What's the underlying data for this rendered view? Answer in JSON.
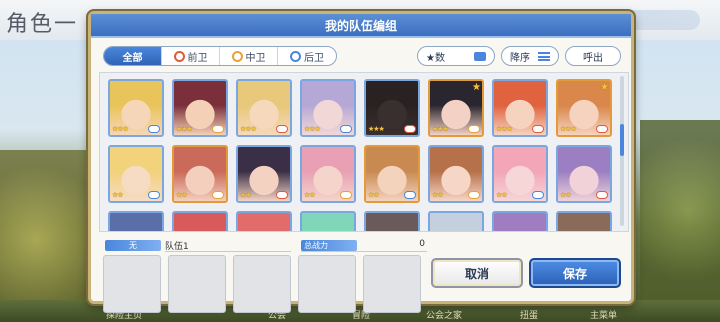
{
  "background": {
    "title": "角色一",
    "bottom_items": [
      "探险主页",
      "公会",
      "冒险",
      "公会之家",
      "扭蛋",
      "主菜单"
    ]
  },
  "dialog": {
    "title": "我的队伍编组",
    "tabs": [
      {
        "label": "全部",
        "active": true
      },
      {
        "label": "前卫",
        "role": "front"
      },
      {
        "label": "中卫",
        "role": "mid"
      },
      {
        "label": "后卫",
        "role": "back"
      }
    ],
    "sort_key": "★数",
    "order": "降序",
    "call_button": "呼出"
  },
  "characters": [
    {
      "stars": "★★★",
      "role": "back",
      "frame": "blue",
      "skin": "#f6d6b8",
      "hair": "#e9c45a"
    },
    {
      "stars": "★★★",
      "role": "mid",
      "frame": "blue",
      "skin": "#f4d0b6",
      "hair": "#7a2f3a"
    },
    {
      "stars": "★★★",
      "role": "front",
      "frame": "blue",
      "skin": "#f6d8bc",
      "hair": "#e8c87a"
    },
    {
      "stars": "★★★",
      "role": "back",
      "frame": "blue",
      "skin": "#f2d7d7",
      "hair": "#b6a8d6"
    },
    {
      "stars": "★★★",
      "role": "front",
      "frame": "blue",
      "skin": "#3a2f2f",
      "hair": "#2a2222"
    },
    {
      "stars": "★★★",
      "role": "mid",
      "frame": "gold",
      "skin": "#f3d1c4",
      "hair": "#2a2630",
      "corner": "★"
    },
    {
      "stars": "★★★",
      "role": "front",
      "frame": "blue",
      "skin": "#f6d3bf",
      "hair": "#e0623f"
    },
    {
      "stars": "★★★",
      "role": "front",
      "frame": "gold",
      "skin": "#f6d3bf",
      "hair": "#d9874a",
      "corner": "★"
    },
    {
      "stars": "★★",
      "role": "back",
      "frame": "blue",
      "skin": "#f6dcc2",
      "hair": "#f2d27a"
    },
    {
      "stars": "★★",
      "role": "mid",
      "frame": "gold",
      "skin": "#f4cfbd",
      "hair": "#c96a5a"
    },
    {
      "stars": "★★",
      "role": "front",
      "frame": "blue",
      "skin": "#f4d2c2",
      "hair": "#3a2f46"
    },
    {
      "stars": "★★",
      "role": "mid",
      "frame": "blue",
      "skin": "#f5d4cc",
      "hair": "#e9a0b4"
    },
    {
      "stars": "★★",
      "role": "back",
      "frame": "gold",
      "skin": "#f4d3bd",
      "hair": "#c98a52"
    },
    {
      "stars": "★★",
      "role": "mid",
      "frame": "blue",
      "skin": "#f6d6c6",
      "hair": "#b7714a"
    },
    {
      "stars": "★★",
      "role": "back",
      "frame": "blue",
      "skin": "#f6d6d6",
      "hair": "#f2a6b8"
    },
    {
      "stars": "★★",
      "role": "front",
      "frame": "blue",
      "skin": "#f0d2d8",
      "hair": "#9b7fc2"
    },
    {
      "stars": "",
      "role": "",
      "frame": "blue",
      "skin": "#9aaedb",
      "hair": "#5a6ea8"
    },
    {
      "stars": "",
      "role": "",
      "frame": "blue",
      "skin": "#f2c9c9",
      "hair": "#d85a5a"
    },
    {
      "stars": "",
      "role": "",
      "frame": "blue",
      "skin": "#f2c9c9",
      "hair": "#e26b6b"
    },
    {
      "stars": "",
      "role": "",
      "frame": "blue",
      "skin": "#d6f0e6",
      "hair": "#7fd6b8"
    },
    {
      "stars": "",
      "role": "",
      "frame": "blue",
      "skin": "#d8cfcf",
      "hair": "#6b5a5a"
    },
    {
      "stars": "",
      "role": "",
      "frame": "blue",
      "skin": "#eef2f6",
      "hair": "#c4d0de"
    },
    {
      "stars": "",
      "role": "",
      "frame": "blue",
      "skin": "#e8d6ee",
      "hair": "#a07cc0"
    },
    {
      "stars": "",
      "role": "",
      "frame": "blue",
      "skin": "#eadad2",
      "hair": "#8a6a5a"
    }
  ],
  "team": {
    "label": "无",
    "name": "队伍1",
    "power_label": "总战力",
    "power_value": "0"
  },
  "actions": {
    "cancel": "取消",
    "save": "保存"
  },
  "colors": {
    "accent": "#3c6fbf",
    "frame_gold": "#e29b3a",
    "frame_blue": "#7aa7e0"
  }
}
